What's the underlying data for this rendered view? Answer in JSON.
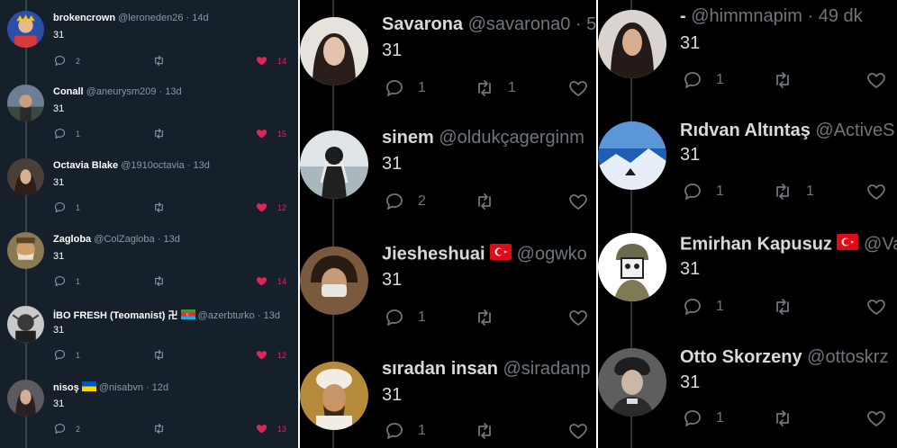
{
  "panel1": {
    "tweets": [
      {
        "name": "brokencrown",
        "handle": "@leroneden26",
        "time": "14d",
        "text": "31",
        "replies": "2",
        "retweets": "",
        "likes": "14"
      },
      {
        "name": "Conall",
        "handle": "@aneurysm209",
        "time": "13d",
        "text": "31",
        "replies": "1",
        "retweets": "",
        "likes": "15"
      },
      {
        "name": "Octavia Blake",
        "handle": "@1910octavia",
        "time": "13d",
        "text": "31",
        "replies": "1",
        "retweets": "",
        "likes": "12"
      },
      {
        "name": "Zagloba",
        "handle": "@ColZagloba",
        "time": "13d",
        "text": "31",
        "replies": "1",
        "retweets": "",
        "likes": "14"
      },
      {
        "name": "İBO FRESH (Teomanist) 卍",
        "handle": "@azerbturko",
        "time": "13d",
        "text": "31",
        "replies": "1",
        "retweets": "",
        "likes": "12"
      },
      {
        "name": "nisoş",
        "handle": "@nisabvn",
        "time": "12d",
        "text": "31",
        "replies": "2",
        "retweets": "",
        "likes": "13"
      }
    ]
  },
  "panel2": {
    "tweets": [
      {
        "name": "Savarona",
        "handle": "@savarona0",
        "time": "5",
        "text": "31",
        "replies": "1",
        "retweets": "1",
        "likes": ""
      },
      {
        "name": "sinem",
        "handle": "@oldukçagerginm",
        "time": "",
        "text": "31",
        "replies": "2",
        "retweets": "",
        "likes": ""
      },
      {
        "name": "Jiesheshuai",
        "handle": "@ogwko",
        "time": "",
        "text": "31",
        "replies": "1",
        "retweets": "",
        "likes": ""
      },
      {
        "name": "sıradan insan",
        "handle": "@siradanp",
        "time": "",
        "text": "31",
        "replies": "1",
        "retweets": "",
        "likes": ""
      }
    ]
  },
  "panel3": {
    "tweets": [
      {
        "name": "-",
        "handle": "@himmnapim",
        "time": "49 dk",
        "text": "31",
        "replies": "1",
        "retweets": "",
        "likes": ""
      },
      {
        "name": "Rıdvan Altıntaş",
        "handle": "@ActiveS",
        "time": "",
        "text": "31",
        "replies": "1",
        "retweets": "1",
        "likes": ""
      },
      {
        "name": "Emirhan Kapusuz",
        "handle": "@Va",
        "time": "",
        "text": "31",
        "replies": "1",
        "retweets": "",
        "likes": ""
      },
      {
        "name": "Otto Skorzeny",
        "handle": "@ottoskrz",
        "time": "",
        "text": "31",
        "replies": "1",
        "retweets": "",
        "likes": ""
      }
    ]
  },
  "icons": {
    "reply": "reply-icon",
    "retweet": "retweet-icon",
    "like": "heart-icon",
    "flag_ukraine": "ukraine-flag-icon",
    "flag_azerbaijan": "azerbaijan-flag-icon",
    "flag_turkey": "turkey-flag-icon"
  },
  "colors": {
    "panel1_bg": "#15202b",
    "panel23_bg": "#000000",
    "like_active": "#e0245e",
    "muted_text": "#8899a6"
  }
}
